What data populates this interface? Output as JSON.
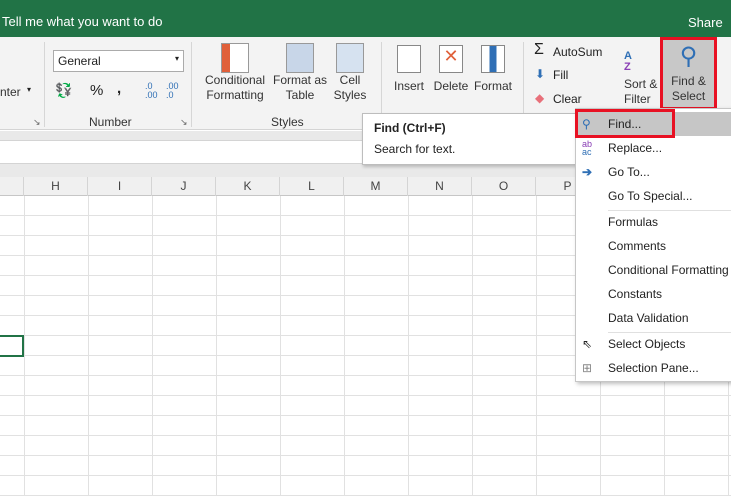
{
  "title_bar": {
    "tell_me": "Tell me what you want to do",
    "share": "Share"
  },
  "ribbon": {
    "alignment_partial": "nter",
    "number": {
      "format_value": "General",
      "percent": "%",
      "comma": ",",
      "inc_decimal": ".0 .00",
      "dec_decimal": ".00 .0",
      "group_label": "Number"
    },
    "styles": {
      "conditional": [
        "Conditional",
        "Formatting"
      ],
      "format_table": [
        "Format as",
        "Table"
      ],
      "cell_styles": [
        "Cell",
        "Styles"
      ],
      "group_label": "Styles"
    },
    "cells": {
      "insert": "Insert",
      "delete": "Delete",
      "format": "Format"
    },
    "editing": {
      "autosum": "AutoSum",
      "fill": "Fill",
      "clear": "Clear",
      "sort": [
        "Sort &",
        "Filter"
      ],
      "find": [
        "Find &",
        "Select"
      ]
    }
  },
  "tooltip": {
    "title": "Find (Ctrl+F)",
    "desc": "Search for text."
  },
  "columns": [
    "H",
    "I",
    "J",
    "K",
    "L",
    "M",
    "N",
    "O",
    "P"
  ],
  "menu": {
    "items": [
      "Find...",
      "Replace...",
      "Go To...",
      "Go To Special...",
      "Formulas",
      "Comments",
      "Conditional Formatting",
      "Constants",
      "Data Validation",
      "Select Objects",
      "Selection Pane..."
    ]
  },
  "colors": {
    "excel_green": "#217346",
    "highlight": "#e81123"
  }
}
